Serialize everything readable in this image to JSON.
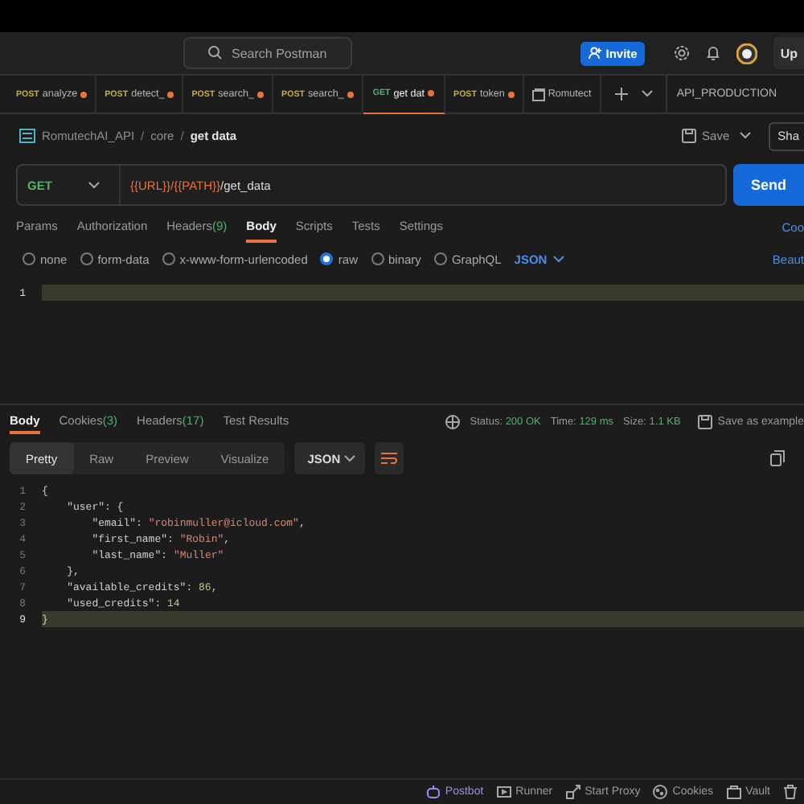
{
  "top_bar": {
    "search": {
      "placeholder": "Search Postman"
    },
    "invite_button": "Invite",
    "upgrade_button": "Up"
  },
  "tabs": [
    {
      "kind": "post",
      "method": "POST",
      "name": "analyze",
      "unsaved": true,
      "selected": false
    },
    {
      "kind": "post",
      "method": "POST",
      "name": "detect_",
      "unsaved": true,
      "selected": false
    },
    {
      "kind": "post",
      "method": "POST",
      "name": "search_",
      "unsaved": true,
      "selected": false
    },
    {
      "kind": "post",
      "method": "POST",
      "name": "search_",
      "unsaved": true,
      "selected": false
    },
    {
      "kind": "get",
      "method": "GET",
      "name": "get dat",
      "unsaved": true,
      "selected": true
    },
    {
      "kind": "post",
      "method": "POST",
      "name": "token",
      "unsaved": true,
      "selected": false
    },
    {
      "kind": "collection",
      "name": "Romutect",
      "unsaved": false,
      "selected": false
    }
  ],
  "environment": "API_PRODUCTION",
  "breadcrumb": [
    {
      "kind": "item",
      "text": "RomutechAI_API"
    },
    {
      "kind": "separator",
      "text": "/"
    },
    {
      "kind": "item",
      "text": "core"
    },
    {
      "kind": "separator",
      "text": "/"
    },
    {
      "kind": "current",
      "text": "get data"
    }
  ],
  "save_button": "Save",
  "share_button": "Sha",
  "request": {
    "method": "GET",
    "url": [
      {
        "kind": "variable",
        "text": "{{URL}}"
      },
      {
        "kind": "variable",
        "text": "/"
      },
      {
        "kind": "variable",
        "text": "{{PATH}}"
      },
      {
        "kind": "plain",
        "text": "/get_data"
      }
    ],
    "send_button": "Send"
  },
  "request_tabs": [
    {
      "label": "Params",
      "selected": false
    },
    {
      "label": "Authorization",
      "selected": false
    },
    {
      "label": "Headers",
      "count": "(9)",
      "selected": false
    },
    {
      "label": "Body",
      "selected": true
    },
    {
      "label": "Scripts",
      "selected": false
    },
    {
      "label": "Tests",
      "selected": false
    },
    {
      "label": "Settings",
      "selected": false
    }
  ],
  "cookies_link": "Coo",
  "body_types": [
    {
      "label": "none",
      "selected": false
    },
    {
      "label": "form-data",
      "selected": false
    },
    {
      "label": "x-www-form-urlencoded",
      "selected": false
    },
    {
      "label": "raw",
      "selected": true
    },
    {
      "label": "binary",
      "selected": false
    },
    {
      "label": "GraphQL",
      "selected": false
    }
  ],
  "body_language": "JSON",
  "beautify_link": "Beaut",
  "request_editor": {
    "lines": [
      {
        "number": "1",
        "current": true
      }
    ]
  },
  "response": {
    "tabs": [
      {
        "label": "Body",
        "selected": true
      },
      {
        "label": "Cookies",
        "count": "(3)",
        "selected": false
      },
      {
        "label": "Headers",
        "count": "(17)",
        "selected": false
      },
      {
        "label": "Test Results",
        "selected": false
      }
    ],
    "status": {
      "label": "Status:",
      "value": "200 OK"
    },
    "time": {
      "label": "Time:",
      "value": "129 ms"
    },
    "size": {
      "label": "Size:",
      "value": "1.1 KB"
    },
    "save_example": "Save as example",
    "view_modes": [
      {
        "label": "Pretty",
        "selected": true
      },
      {
        "label": "Raw",
        "selected": false
      },
      {
        "label": "Preview",
        "selected": false
      },
      {
        "label": "Visualize",
        "selected": false
      }
    ],
    "format": "JSON",
    "lines": [
      {
        "number": "1",
        "current": false,
        "tokens": [
          {
            "kind": "punct",
            "text": "{"
          }
        ],
        "children": [
          {
            "number": "2",
            "current": false,
            "tokens": [
              {
                "kind": "key",
                "text": "\"user\""
              },
              {
                "kind": "punct",
                "text": ": {"
              }
            ],
            "children": [
              {
                "number": "3",
                "current": false,
                "tokens": [
                  {
                    "kind": "key",
                    "text": "\"email\""
                  },
                  {
                    "kind": "punct",
                    "text": ": "
                  },
                  {
                    "kind": "string",
                    "text": "\"robinmuller@icloud.com\""
                  },
                  {
                    "kind": "punct",
                    "text": ","
                  }
                ]
              },
              {
                "number": "4",
                "current": false,
                "tokens": [
                  {
                    "kind": "key",
                    "text": "\"first_name\""
                  },
                  {
                    "kind": "punct",
                    "text": ": "
                  },
                  {
                    "kind": "string",
                    "text": "\"Robin\""
                  },
                  {
                    "kind": "punct",
                    "text": ","
                  }
                ]
              },
              {
                "number": "5",
                "current": false,
                "tokens": [
                  {
                    "kind": "key",
                    "text": "\"last_name\""
                  },
                  {
                    "kind": "punct",
                    "text": ": "
                  },
                  {
                    "kind": "string",
                    "text": "\"Muller\""
                  }
                ]
              }
            ]
          },
          {
            "number": "6",
            "current": false,
            "tokens": [
              {
                "kind": "punct",
                "text": "},"
              }
            ]
          },
          {
            "number": "7",
            "current": false,
            "tokens": [
              {
                "kind": "key",
                "text": "\"available_credits\""
              },
              {
                "kind": "punct",
                "text": ": "
              },
              {
                "kind": "number",
                "text": "86"
              },
              {
                "kind": "punct",
                "text": ","
              }
            ]
          },
          {
            "number": "8",
            "current": false,
            "tokens": [
              {
                "kind": "key",
                "text": "\"used_credits\""
              },
              {
                "kind": "punct",
                "text": ": "
              },
              {
                "kind": "number",
                "text": "14"
              }
            ]
          }
        ]
      },
      {
        "number": "9",
        "current": true,
        "tokens": [
          {
            "kind": "punct",
            "text": "}"
          }
        ]
      }
    ]
  },
  "footer": [
    {
      "kind": "bot",
      "label": "Postbot"
    },
    {
      "kind": "runner",
      "label": "Runner"
    },
    {
      "kind": "proxy",
      "label": "Start Proxy"
    },
    {
      "kind": "cookies",
      "label": "Cookies"
    },
    {
      "kind": "vault",
      "label": "Vault"
    },
    {
      "kind": "trash"
    }
  ]
}
